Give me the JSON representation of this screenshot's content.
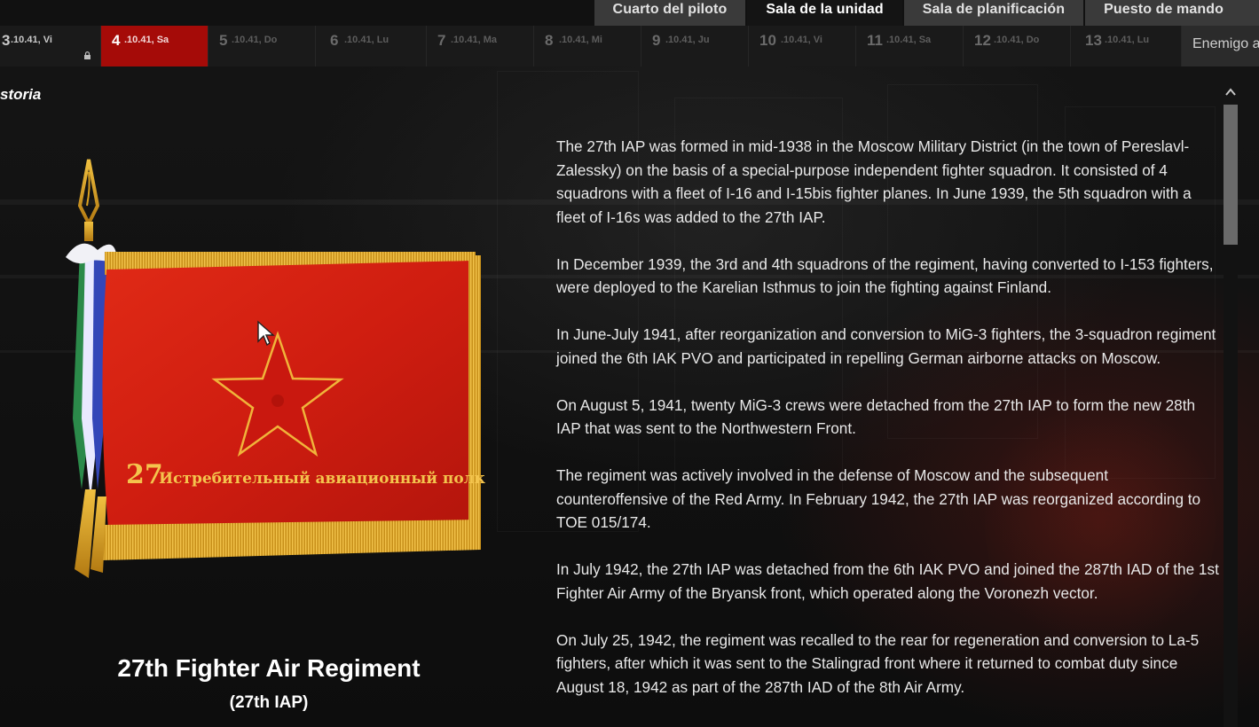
{
  "nav": {
    "tabs": [
      {
        "label": "Cuarto del piloto",
        "active": false
      },
      {
        "label": "Sala de la unidad",
        "active": true
      },
      {
        "label": "Sala de planificación",
        "active": false
      },
      {
        "label": "Puesto de mando",
        "active": false
      }
    ]
  },
  "days": [
    {
      "num": "3",
      "date": ".10.41, Vi"
    },
    {
      "num": "4",
      "date": ".10.41, Sa"
    },
    {
      "num": "5",
      "date": ".10.41, Do"
    },
    {
      "num": "6",
      "date": ".10.41, Lu"
    },
    {
      "num": "7",
      "date": ".10.41, Ma"
    },
    {
      "num": "8",
      "date": ".10.41, Mi"
    },
    {
      "num": "9",
      "date": ".10.41, Ju"
    },
    {
      "num": "10",
      "date": ".10.41, Vi"
    },
    {
      "num": "11",
      "date": ".10.41, Sa"
    },
    {
      "num": "12",
      "date": ".10.41, Do"
    },
    {
      "num": "13",
      "date": ".10.41, Lu"
    }
  ],
  "enemy_label": "Enemigo a",
  "section_title": "storia",
  "flag": {
    "inscription_num": "27",
    "inscription_text": "Истребительный авиационный полк",
    "cloth_color": "#d81f12",
    "fringe_color": "#d9a020"
  },
  "regiment": {
    "name": "27th Fighter Air Regiment",
    "abbr": "(27th IAP)"
  },
  "history": [
    "The 27th IAP was formed in mid-1938 in the Moscow Military District (in the town of Pereslavl-Zalessky) on the basis of a special-purpose independent fighter squadron. It consisted of 4 squadrons with a fleet of I-16 and I-15bis fighter planes. In June 1939, the 5th squadron with a fleet of I-16s was added to the 27th IAP.",
    "In December 1939, the 3rd and 4th squadrons of the regiment, having converted to I-153 fighters, were deployed to the Karelian Isthmus to join the fighting against Finland.",
    "In June-July 1941, after reorganization and conversion to MiG-3 fighters, the 3-squadron regiment joined the 6th IAK PVO and participated in repelling German airborne attacks on Moscow.",
    "On August 5, 1941, twenty MiG-3 crews were detached from the 27th IAP to form the new 28th IAP that was sent to the Northwestern Front.",
    "The regiment was actively involved in the defense of Moscow and the subsequent counteroffensive of the Red Army. In February 1942, the 27th IAP was reorganized according to TOE 015/174.",
    "In July 1942, the 27th IAP was detached from the 6th IAK PVO and joined the 287th IAD of the 1st Fighter Air Army of the Bryansk front, which operated along the Voronezh vector.",
    "On July 25, 1942, the regiment was recalled to the rear for regeneration and conversion to La-5 fighters, after which it was sent to the Stalingrad front where it returned to combat duty since August 18, 1942 as part of the 287th IAD of the 8th Air Army."
  ],
  "icons": {
    "scroll_up": "chevron-up-icon",
    "cursor": "mouse-pointer-icon",
    "day_badge": "lock-icon"
  }
}
